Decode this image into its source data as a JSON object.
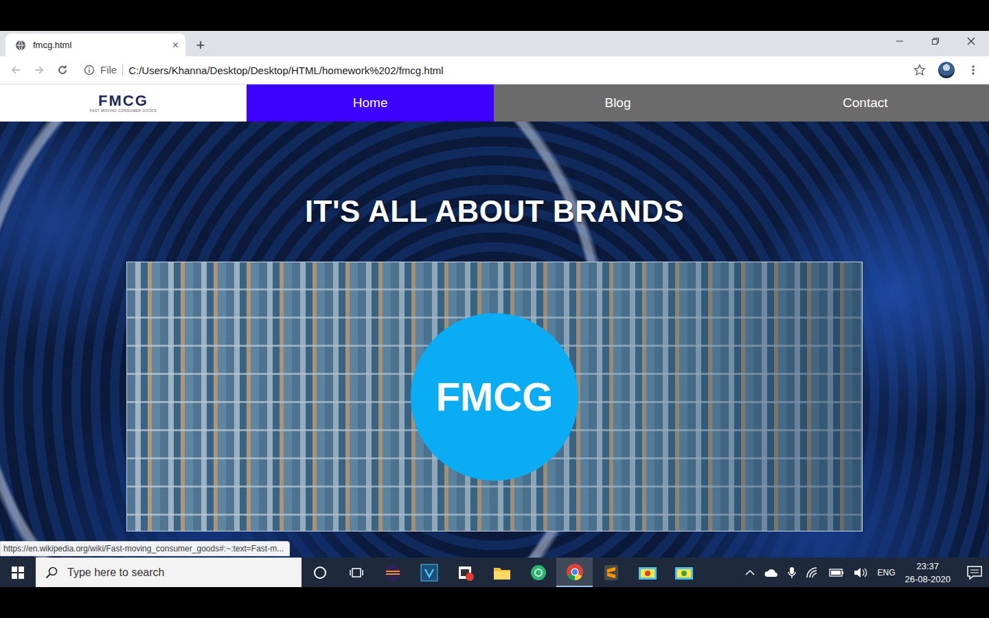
{
  "browser": {
    "tab": {
      "title": "fmcg.html",
      "close": "×",
      "selected": true
    },
    "new_tab": "+",
    "address": {
      "scheme": "File",
      "url": "C:/Users/Khanna/Desktop/Desktop/HTML/homework%202/fmcg.html"
    }
  },
  "page": {
    "logo": {
      "name": "FMCG",
      "tagline": "FAST MOVING CONSUMER GOODS"
    },
    "nav": [
      {
        "label": "Home",
        "selected": true
      },
      {
        "label": "Blog",
        "selected": false
      },
      {
        "label": "Contact",
        "selected": false
      }
    ],
    "heading": "IT'S ALL ABOUT BRANDS",
    "badge": "FMCG"
  },
  "status_bar": "https://en.wikipedia.org/wiki/Fast-moving_consumer_goods#:~:text=Fast-m...",
  "taskbar": {
    "search_placeholder": "Type here to search",
    "language": "ENG",
    "time": "23:37",
    "date": "26-08-2020"
  }
}
